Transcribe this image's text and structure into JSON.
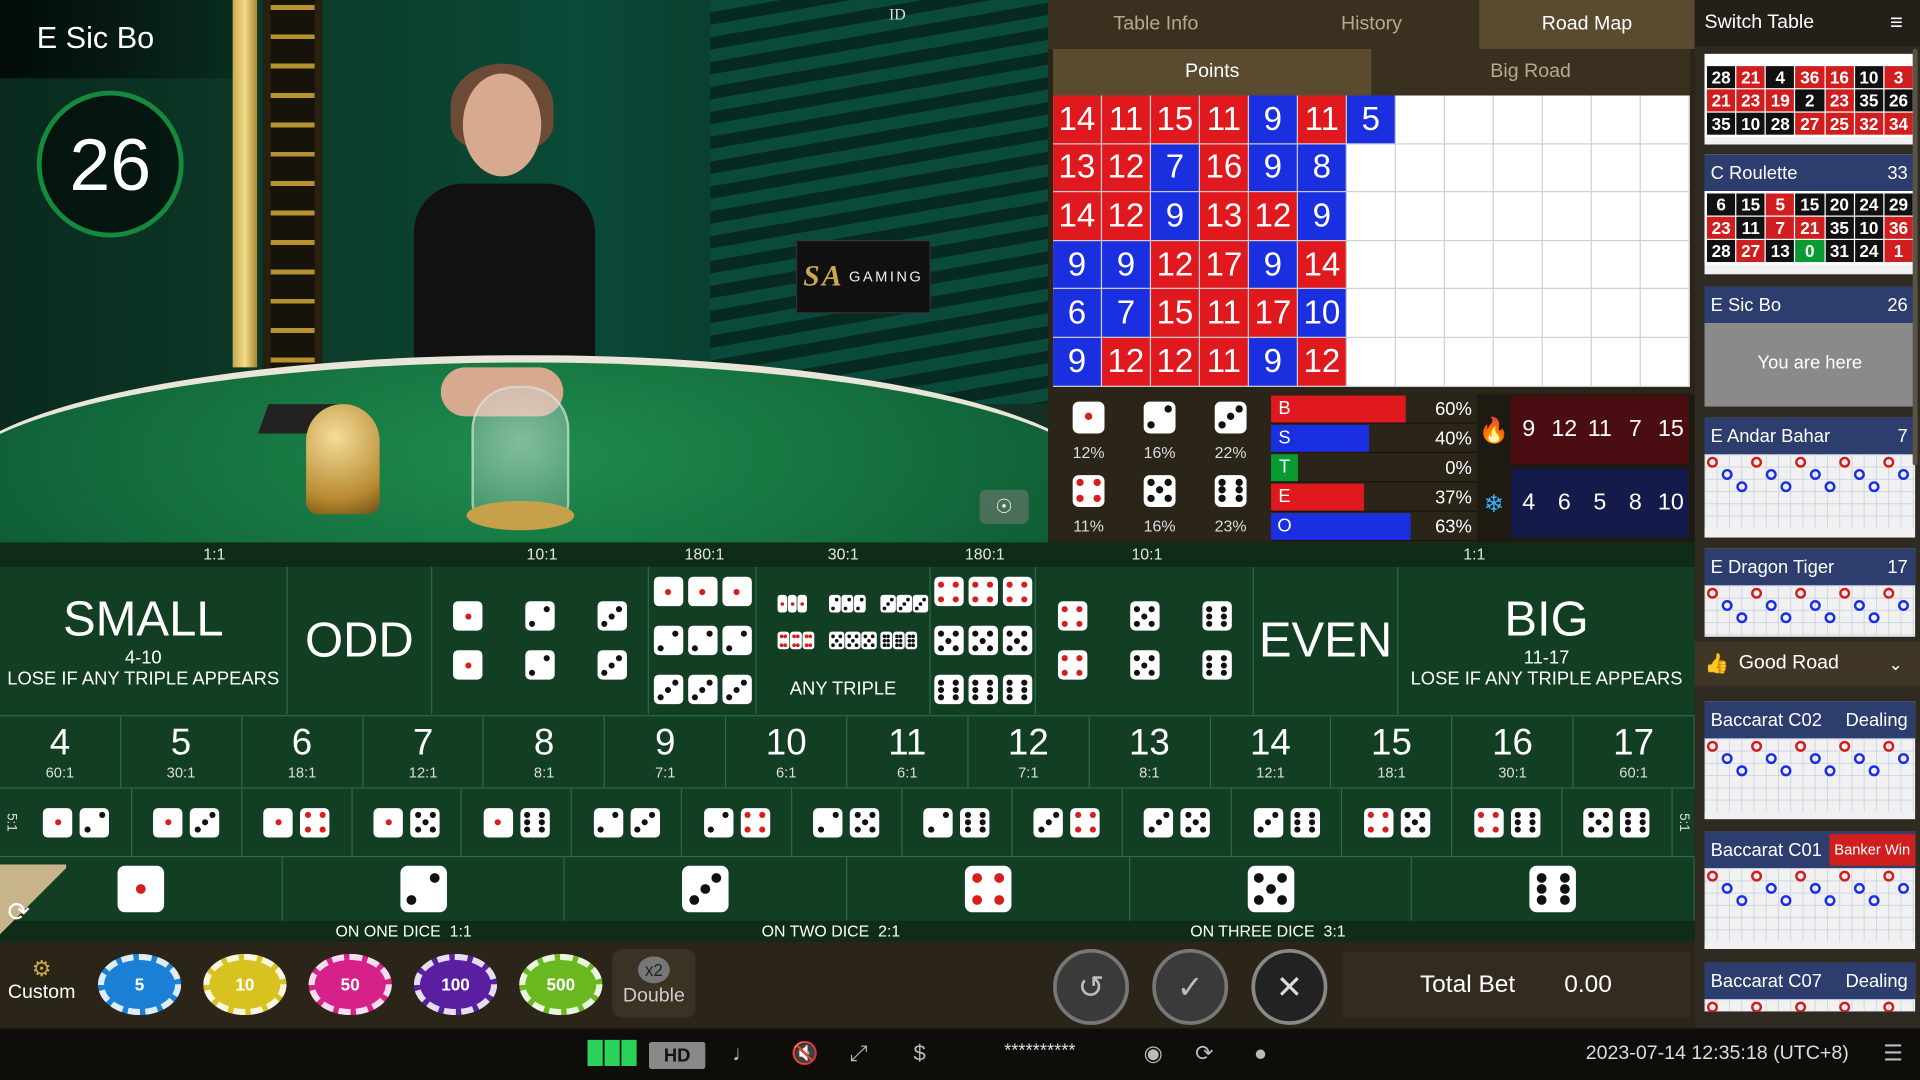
{
  "game": {
    "title": "E Sic Bo",
    "timer": "26",
    "id_label": "ID"
  },
  "brand": {
    "logo": "SA",
    "logo_text": "GAMING"
  },
  "info_tabs": [
    {
      "label": "Table Info"
    },
    {
      "label": "History"
    },
    {
      "label": "Road Map",
      "active": true
    }
  ],
  "sub_tabs": [
    {
      "label": "Points",
      "active": true
    },
    {
      "label": "Big Road"
    }
  ],
  "points_grid": [
    [
      {
        "v": "14",
        "c": "r"
      },
      {
        "v": "11",
        "c": "r"
      },
      {
        "v": "15",
        "c": "r"
      },
      {
        "v": "11",
        "c": "r"
      },
      {
        "v": "9",
        "c": "b"
      },
      {
        "v": "11",
        "c": "r"
      },
      {
        "v": "5",
        "c": "b"
      }
    ],
    [
      {
        "v": "13",
        "c": "r"
      },
      {
        "v": "12",
        "c": "r"
      },
      {
        "v": "7",
        "c": "b"
      },
      {
        "v": "16",
        "c": "r"
      },
      {
        "v": "9",
        "c": "b"
      },
      {
        "v": "8",
        "c": "b"
      }
    ],
    [
      {
        "v": "14",
        "c": "r"
      },
      {
        "v": "12",
        "c": "r"
      },
      {
        "v": "9",
        "c": "b"
      },
      {
        "v": "13",
        "c": "r"
      },
      {
        "v": "12",
        "c": "r"
      },
      {
        "v": "9",
        "c": "b"
      }
    ],
    [
      {
        "v": "9",
        "c": "b"
      },
      {
        "v": "9",
        "c": "b"
      },
      {
        "v": "12",
        "c": "r"
      },
      {
        "v": "17",
        "c": "r"
      },
      {
        "v": "9",
        "c": "b"
      },
      {
        "v": "14",
        "c": "r"
      }
    ],
    [
      {
        "v": "6",
        "c": "b"
      },
      {
        "v": "7",
        "c": "b"
      },
      {
        "v": "15",
        "c": "r"
      },
      {
        "v": "11",
        "c": "r"
      },
      {
        "v": "17",
        "c": "r"
      },
      {
        "v": "10",
        "c": "b"
      }
    ],
    [
      {
        "v": "9",
        "c": "b"
      },
      {
        "v": "12",
        "c": "r"
      },
      {
        "v": "12",
        "c": "r"
      },
      {
        "v": "11",
        "c": "r"
      },
      {
        "v": "9",
        "c": "b"
      },
      {
        "v": "12",
        "c": "r"
      }
    ]
  ],
  "dice_stats": [
    {
      "face": 1,
      "pct": "12%"
    },
    {
      "face": 2,
      "pct": "16%"
    },
    {
      "face": 3,
      "pct": "22%"
    },
    {
      "face": 4,
      "pct": "11%"
    },
    {
      "face": 5,
      "pct": "16%"
    },
    {
      "face": 6,
      "pct": "23%"
    }
  ],
  "result_bars": [
    {
      "key": "B",
      "color": "#e0191f",
      "fill": 0.6,
      "pct": "60%"
    },
    {
      "key": "S",
      "color": "#1a2fe0",
      "fill": 0.4,
      "pct": "40%"
    },
    {
      "key": "T",
      "color": "#0a9a33",
      "fill": 0.0,
      "pct": "0%"
    },
    {
      "key": "E",
      "color": "#e0191f",
      "fill": 0.37,
      "pct": "37%"
    },
    {
      "key": "O",
      "color": "#1a2fe0",
      "fill": 0.63,
      "pct": "63%"
    }
  ],
  "hot_numbers": [
    "9",
    "12",
    "11",
    "7",
    "15"
  ],
  "cold_numbers": [
    "4",
    "6",
    "5",
    "8",
    "10"
  ],
  "icons": {
    "hot": "fire-icon",
    "cold": "snowflake-icon",
    "camera": "camera-icon",
    "refresh": "refresh-icon"
  },
  "payouts": {
    "small_big": "1:1",
    "double": "10:1",
    "triple": "180:1",
    "any_triple": "30:1"
  },
  "small": {
    "title": "SMALL",
    "range": "4-10",
    "note": "LOSE IF ANY TRIPLE APPEARS"
  },
  "odd": {
    "title": "ODD"
  },
  "even": {
    "title": "EVEN"
  },
  "big": {
    "title": "BIG",
    "range": "11-17",
    "note": "LOSE IF ANY TRIPLE APPEARS"
  },
  "any_triple_label": "ANY TRIPLE",
  "sums": [
    {
      "n": "4",
      "o": "60:1"
    },
    {
      "n": "5",
      "o": "30:1"
    },
    {
      "n": "6",
      "o": "18:1"
    },
    {
      "n": "7",
      "o": "12:1"
    },
    {
      "n": "8",
      "o": "8:1"
    },
    {
      "n": "9",
      "o": "7:1"
    },
    {
      "n": "10",
      "o": "6:1"
    },
    {
      "n": "11",
      "o": "6:1"
    },
    {
      "n": "12",
      "o": "7:1"
    },
    {
      "n": "13",
      "o": "8:1"
    },
    {
      "n": "14",
      "o": "12:1"
    },
    {
      "n": "15",
      "o": "18:1"
    },
    {
      "n": "16",
      "o": "30:1"
    },
    {
      "n": "17",
      "o": "60:1"
    }
  ],
  "combo_payout": "5:1",
  "combos": [
    [
      1,
      2
    ],
    [
      1,
      3
    ],
    [
      1,
      4
    ],
    [
      1,
      5
    ],
    [
      1,
      6
    ],
    [
      2,
      3
    ],
    [
      2,
      4
    ],
    [
      2,
      5
    ],
    [
      2,
      6
    ],
    [
      3,
      4
    ],
    [
      3,
      5
    ],
    [
      3,
      6
    ],
    [
      4,
      5
    ],
    [
      4,
      6
    ],
    [
      5,
      6
    ]
  ],
  "single_labels": {
    "one": "ON ONE DICE",
    "one_pay": "1:1",
    "two": "ON TWO DICE",
    "two_pay": "2:1",
    "three": "ON THREE DICE",
    "three_pay": "3:1"
  },
  "chips": [
    {
      "value": "5",
      "color": "#1b7fd6"
    },
    {
      "value": "10",
      "color": "#d8c220"
    },
    {
      "value": "50",
      "color": "#d6208a"
    },
    {
      "value": "100",
      "color": "#5a1fa0"
    },
    {
      "value": "500",
      "color": "#6ab820"
    }
  ],
  "custom_label": "Custom",
  "double_label": "Double",
  "double_badge": "x2",
  "total_bet": {
    "label": "Total Bet",
    "value": "0.00"
  },
  "bottom": {
    "password": "**********",
    "hd": "HD",
    "datetime": "2023-07-14  12:35:18 (UTC+8)"
  },
  "lobby": {
    "switch_label": "Switch Table",
    "tables": [
      {
        "name": "C Roulette",
        "count": "33",
        "numbers": [
          [
            "6",
            "blk"
          ],
          [
            "15",
            "blk"
          ],
          [
            "5",
            "red"
          ],
          [
            "15",
            "blk"
          ],
          [
            "20",
            "blk"
          ],
          [
            "24",
            "blk"
          ],
          [
            "29",
            "blk"
          ],
          [
            "23",
            "red"
          ],
          [
            "11",
            "blk"
          ],
          [
            "7",
            "red"
          ],
          [
            "21",
            "red"
          ],
          [
            "35",
            "blk"
          ],
          [
            "10",
            "blk"
          ],
          [
            "36",
            "red"
          ],
          [
            "28",
            "blk"
          ],
          [
            "27",
            "red"
          ],
          [
            "13",
            "blk"
          ],
          [
            "0",
            "grn"
          ],
          [
            "31",
            "blk"
          ],
          [
            "24",
            "blk"
          ],
          [
            "1",
            "red"
          ]
        ]
      },
      {
        "name": "E Sic Bo",
        "count": "26",
        "note": "You are here"
      },
      {
        "name": "E Andar Bahar",
        "count": "7"
      },
      {
        "name": "E Dragon Tiger",
        "count": "17"
      },
      {
        "name": "Baccarat C02",
        "status": "Dealing"
      },
      {
        "name": "Baccarat C01",
        "status": "Banker Win"
      },
      {
        "name": "Baccarat C07",
        "status": "Dealing"
      }
    ],
    "top_partial_numbers": [
      [
        "28",
        "blk"
      ],
      [
        "21",
        "red"
      ],
      [
        "4",
        "blk"
      ],
      [
        "36",
        "red"
      ],
      [
        "16",
        "red"
      ],
      [
        "10",
        "blk"
      ],
      [
        "3",
        "red"
      ],
      [
        "21",
        "red"
      ],
      [
        "23",
        "red"
      ],
      [
        "19",
        "red"
      ],
      [
        "2",
        "blk"
      ],
      [
        "23",
        "red"
      ],
      [
        "35",
        "blk"
      ],
      [
        "26",
        "blk"
      ],
      [
        "35",
        "blk"
      ],
      [
        "10",
        "blk"
      ],
      [
        "28",
        "blk"
      ],
      [
        "27",
        "red"
      ],
      [
        "25",
        "red"
      ],
      [
        "32",
        "red"
      ],
      [
        "34",
        "red"
      ]
    ],
    "good_road": "Good Road"
  }
}
